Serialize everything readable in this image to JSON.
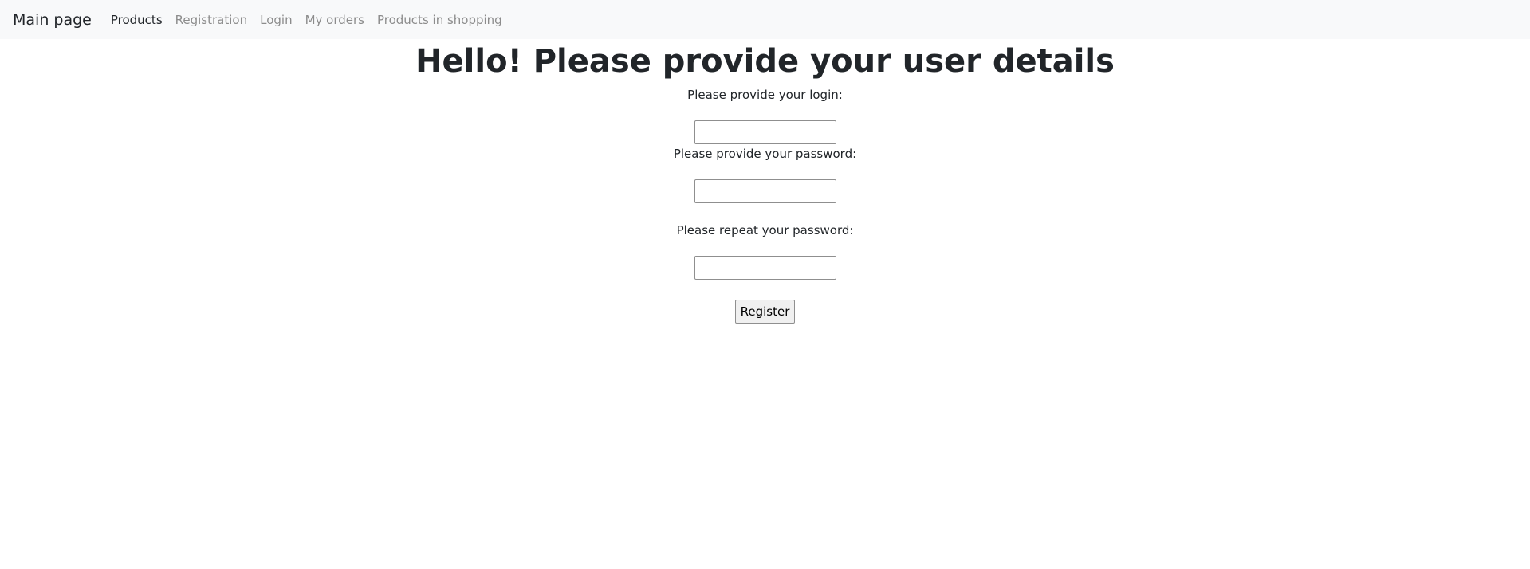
{
  "nav": {
    "brand": "Main page",
    "links": [
      {
        "label": "Products",
        "active": true
      },
      {
        "label": "Registration",
        "active": false
      },
      {
        "label": "Login",
        "active": false
      },
      {
        "label": "My orders",
        "active": false
      },
      {
        "label": "Products in shopping",
        "active": false
      }
    ]
  },
  "form": {
    "heading": "Hello! Please provide your user details",
    "login_label": "Please provide your login:",
    "login_value": "",
    "password_label": "Please provide your password:",
    "password_value": "",
    "repeat_label": "Please repeat your password:",
    "repeat_value": "",
    "submit_label": "Register"
  }
}
